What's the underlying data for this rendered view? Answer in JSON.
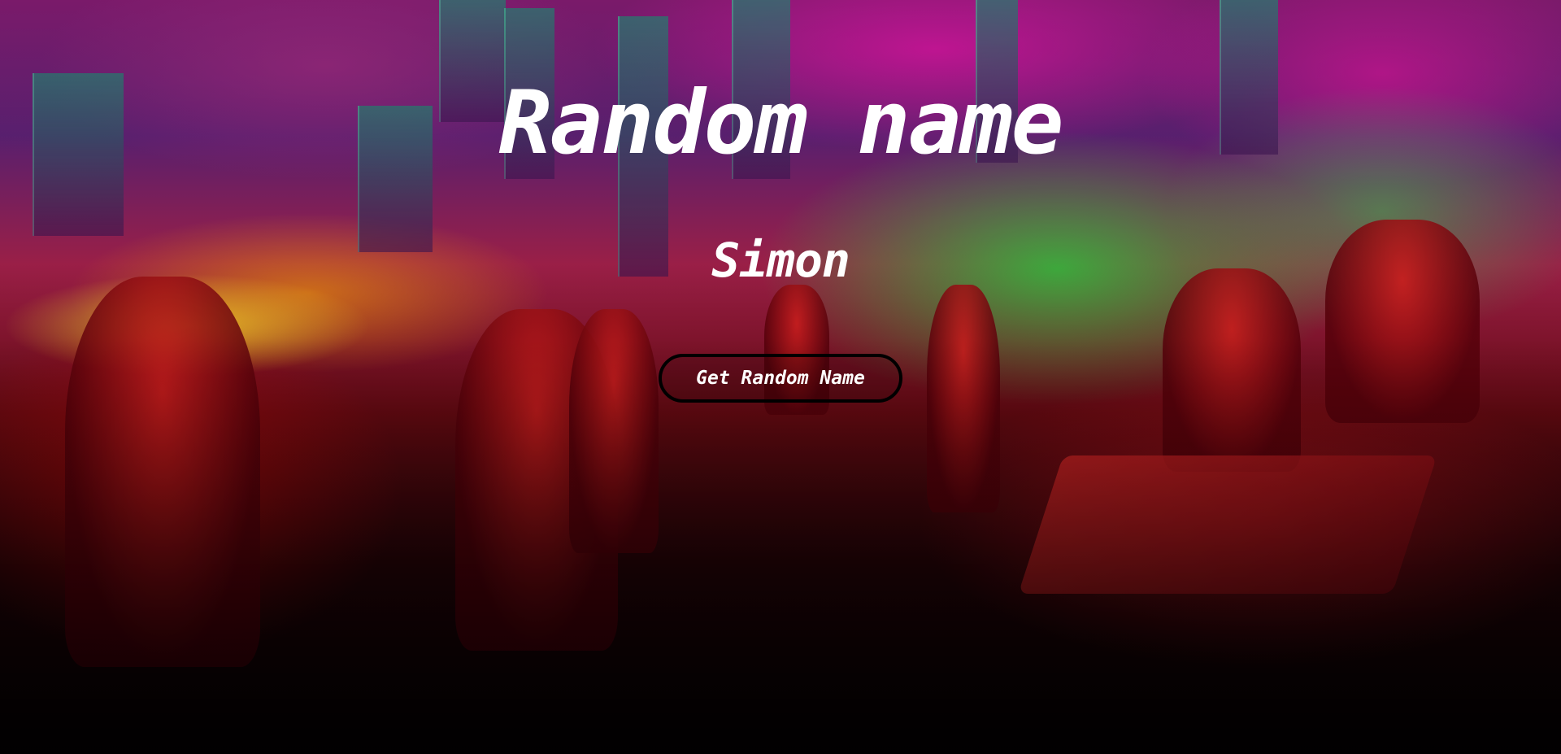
{
  "page": {
    "title": "Random name",
    "generated_name": "Simon",
    "button_label": "Get Random Name"
  },
  "theme": {
    "text_color": "#ffffff",
    "button_border_color": "#000000",
    "background_palette": [
      "#7a1a6a",
      "#a0204a",
      "#28d23c",
      "#ffdc28",
      "#c81e1e",
      "#080104"
    ]
  },
  "background": {
    "icon": "cyberpunk-city-illustration"
  }
}
